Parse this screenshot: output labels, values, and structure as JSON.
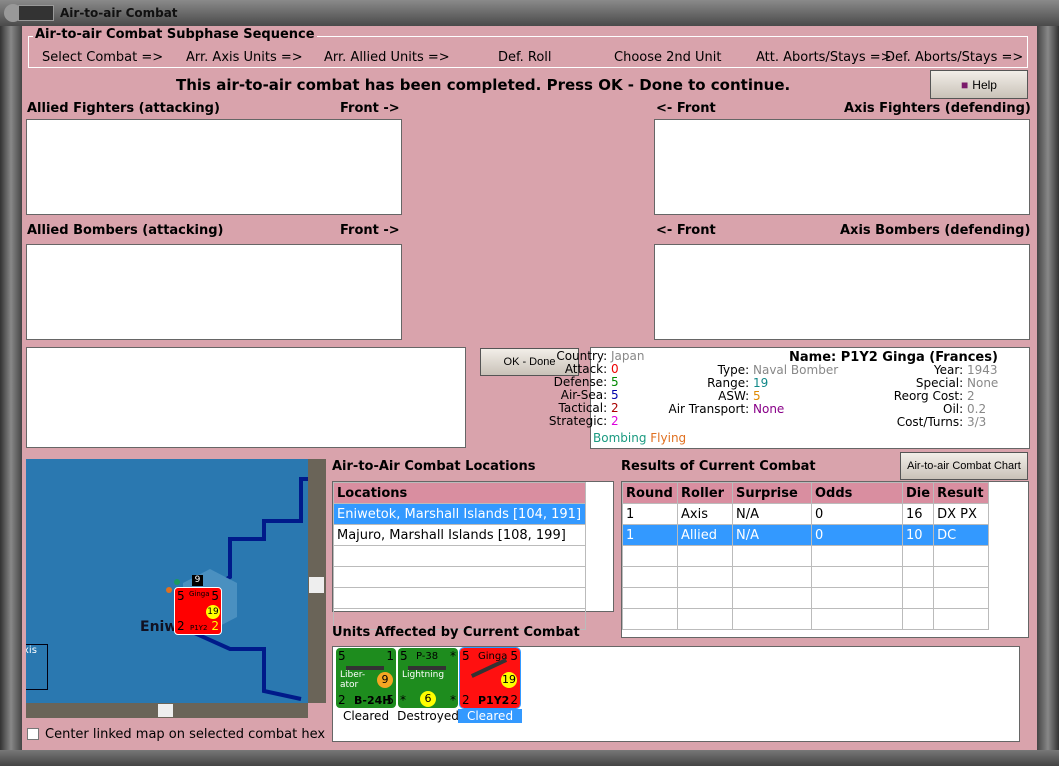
{
  "window": {
    "title": "Air-to-air Combat"
  },
  "subphase": {
    "title": "Air-to-air Combat Subphase Sequence",
    "steps": [
      "Select Combat =>",
      "Arr. Axis Units =>",
      "Arr. Allied Units =>",
      "Def. Roll",
      "Choose 2nd Unit",
      "Att. Aborts/Stays =>",
      "Def. Aborts/Stays =>"
    ]
  },
  "status": "This air-to-air combat has been completed.  Press OK - Done to continue.",
  "help_label": "Help",
  "panels": {
    "allied_fighters": "Allied Fighters (attacking)",
    "axis_fighters": "Axis Fighters (defending)",
    "allied_bombers": "Allied Bombers (attacking)",
    "axis_bombers": "Axis Bombers (defending)",
    "front_right": "Front ->",
    "front_left": "<- Front"
  },
  "ok_label": "OK - Done",
  "unit_info": {
    "country_l": "Country:",
    "country": "Japan",
    "attack_l": "Attack:",
    "attack": "0",
    "defense_l": "Defense:",
    "defense": "5",
    "airsea_l": "Air-Sea:",
    "airsea": "5",
    "tactical_l": "Tactical:",
    "tactical": "2",
    "strategic_l": "Strategic:",
    "strategic": "2",
    "bombing": "Bombing",
    "flying": "Flying",
    "name_l": "Name:",
    "name": "P1Y2 Ginga (Frances)",
    "type_l": "Type:",
    "type": "Naval Bomber",
    "range_l": "Range:",
    "range": "19",
    "asw_l": "ASW:",
    "asw": "5",
    "airtrans_l": "Air Transport:",
    "airtrans": "None",
    "year_l": "Year:",
    "year": "1943",
    "special_l": "Special:",
    "special": "None",
    "reorg_l": "Reorg Cost:",
    "reorg": "2",
    "oil_l": "Oil:",
    "oil": "0.2",
    "cost_l": "Cost/Turns:",
    "cost": "3/3"
  },
  "map": {
    "hex_label": "Eniw",
    "side_label": "xis",
    "stack_count": "9",
    "counter": {
      "name": "Ginga",
      "model": "P1Y2",
      "tl": "5",
      "tr": "5",
      "bl": "2",
      "br": "2",
      "range": "19"
    },
    "center_checkbox": "Center linked map on selected combat hex",
    "center_checked": false
  },
  "locations": {
    "title": "Air-to-Air Combat Locations",
    "header": "Locations",
    "rows": [
      "Eniwetok, Marshall Islands [104, 191]",
      "Majuro, Marshall Islands [108, 199]"
    ],
    "selected": 0
  },
  "results": {
    "title": "Results of Current Combat",
    "chart_button": "Air-to-air Combat Chart",
    "headers": [
      "Round",
      "Roller",
      "Surprise",
      "Odds",
      "Die",
      "Result"
    ],
    "rows": [
      [
        "1",
        "Axis",
        "N/A",
        "0",
        "16",
        "DX PX"
      ],
      [
        "1",
        "Allied",
        "N/A",
        "0",
        "10",
        "DC"
      ]
    ],
    "selected": 1
  },
  "affected": {
    "title": "Units Affected by Current Combat",
    "units": [
      {
        "top": "",
        "name": "Liber-ator",
        "model": "B-24H",
        "tl": "5",
        "tr": "1",
        "bl": "2",
        "br": "5",
        "range": "9",
        "status": "Cleared",
        "color": "#1e8c1e",
        "badge": "#f5a623"
      },
      {
        "top": "P-38",
        "name": "Lightning",
        "model": "",
        "tl": "5",
        "tr": "*",
        "bl": "*",
        "br": "*",
        "range": "6",
        "status": "Destroyed",
        "color": "#1e8c1e",
        "badge": "#ffff00"
      },
      {
        "top": "Ginga",
        "name": "",
        "model": "P1Y2",
        "tl": "5",
        "tr": "5",
        "bl": "2",
        "br": "2",
        "range": "19",
        "status": "Cleared",
        "color": "#ff1010",
        "badge": "#ffff00"
      }
    ],
    "selected": 2
  },
  "colors": {
    "background": "#d9a3ac",
    "header": "#d98ea0",
    "selection": "#3399ff",
    "sea": "#2a78b0"
  }
}
